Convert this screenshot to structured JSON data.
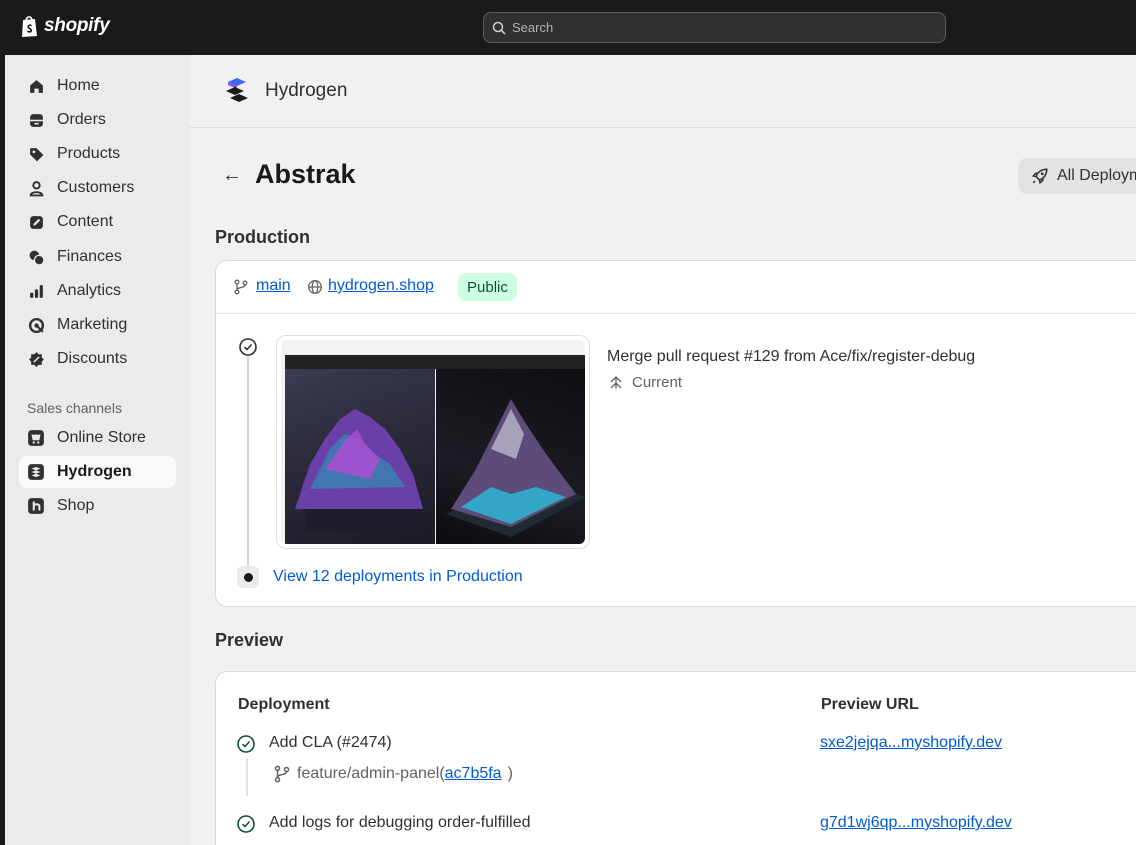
{
  "topbar": {
    "brand": "shopify",
    "search_placeholder": "Search"
  },
  "sidebar": {
    "items": [
      {
        "label": "Home",
        "icon": "home-icon"
      },
      {
        "label": "Orders",
        "icon": "orders-icon"
      },
      {
        "label": "Products",
        "icon": "tag-icon"
      },
      {
        "label": "Customers",
        "icon": "person-icon"
      },
      {
        "label": "Content",
        "icon": "content-icon"
      },
      {
        "label": "Finances",
        "icon": "finances-icon"
      },
      {
        "label": "Analytics",
        "icon": "analytics-icon"
      },
      {
        "label": "Marketing",
        "icon": "marketing-icon"
      },
      {
        "label": "Discounts",
        "icon": "discount-icon"
      }
    ],
    "sales_channels_label": "Sales channels",
    "channels": [
      {
        "label": "Online Store",
        "icon": "store-icon"
      },
      {
        "label": "Hydrogen",
        "icon": "hydrogen-icon",
        "active": true
      },
      {
        "label": "Shop",
        "icon": "shop-icon"
      }
    ]
  },
  "app": {
    "name": "Hydrogen"
  },
  "page": {
    "title": "Abstrak",
    "all_deployments_label": "All Deploym"
  },
  "production": {
    "heading": "Production",
    "branch": "main",
    "domain": "hydrogen.shop",
    "visibility": "Public",
    "commit_message": "Merge pull request #129 from Ace/fix/register-debug",
    "status": "Current",
    "view_link": "View 12 deployments in Production"
  },
  "preview": {
    "heading": "Preview",
    "col_deployment": "Deployment",
    "col_url": "Preview URL",
    "rows": [
      {
        "title": "Add CLA (#2474)",
        "branch": "feature/admin-panel",
        "commit": "ac7b5fa",
        "url": "sxe2jejqa...myshopify.dev"
      },
      {
        "title": "Add logs for debugging order-fulfilled",
        "url": "g7d1wj6qp...myshopify.dev"
      }
    ]
  },
  "colors": {
    "accent_link": "#005bd3",
    "success": "#0c5132",
    "badge_bg": "#cdfee1",
    "topbar": "#1a1a1a"
  }
}
